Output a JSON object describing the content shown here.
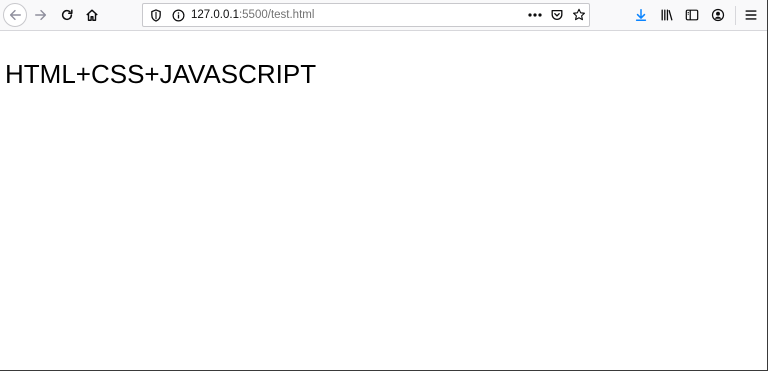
{
  "browser": {
    "url": {
      "host": "127.0.0.1",
      "rest": ":5500/test.html"
    },
    "accent_color": "#0a84ff"
  },
  "page": {
    "heading": "HTML+CSS+JAVASCRIPT"
  }
}
